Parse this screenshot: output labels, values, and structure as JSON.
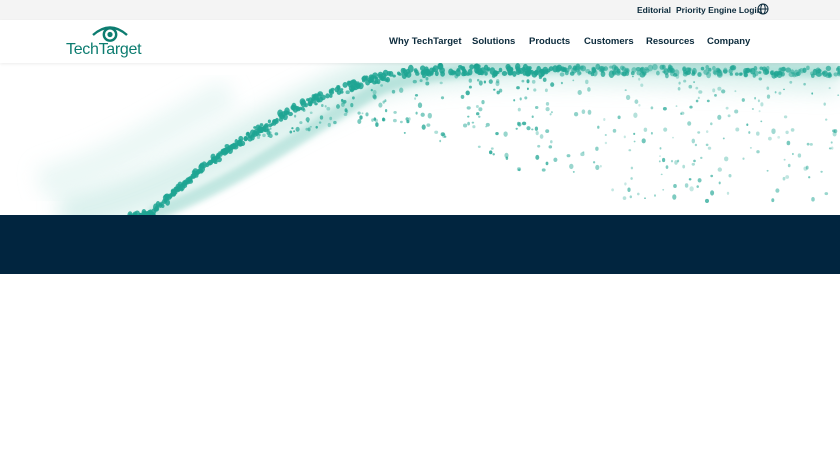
{
  "utility_bar": {
    "editorial": "Editorial",
    "priority_engine_login": "Priority Engine Login",
    "globe_icon": "globe-icon"
  },
  "header": {
    "logo_text": "TechTarget",
    "logo_icon": "eye-icon",
    "nav": [
      {
        "label": "Why TechTarget"
      },
      {
        "label": "Solutions"
      },
      {
        "label": "Products"
      },
      {
        "label": "Customers"
      },
      {
        "label": "Resources"
      },
      {
        "label": "Company"
      }
    ]
  },
  "colors": {
    "brand_teal": "#0c7c70",
    "hero_dots": "#1fa593",
    "nav_text": "#0b2a3b",
    "dark_band": "#01253f",
    "utility_bg": "#f4f4f4"
  }
}
